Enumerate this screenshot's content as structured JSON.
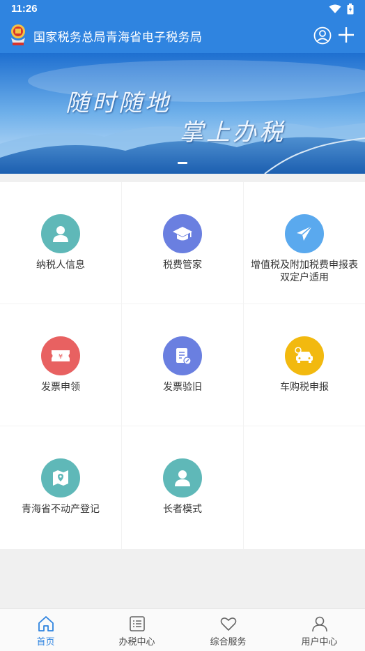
{
  "status": {
    "time": "11:26"
  },
  "header": {
    "title": "国家税务总局青海省电子税务局"
  },
  "banner": {
    "line1": "随时随地",
    "line2": "掌上办税"
  },
  "colors": {
    "primary": "#2f84e0",
    "teal": "#5fb8b8",
    "indigo": "#6a7fe0",
    "sky": "#5aa9ee",
    "red": "#e86161",
    "amber": "#f2b90f"
  },
  "grid": {
    "items": [
      {
        "label": "纳税人信息",
        "icon": "user-icon"
      },
      {
        "label": "税费管家",
        "icon": "graduation-cap-icon"
      },
      {
        "label": "增值税及附加税费申报表双定户适用",
        "icon": "paper-plane-icon"
      },
      {
        "label": "发票申领",
        "icon": "ticket-icon"
      },
      {
        "label": "发票验旧",
        "icon": "document-edit-icon"
      },
      {
        "label": "车购税申报",
        "icon": "car-icon"
      },
      {
        "label": "青海省不动产登记",
        "icon": "map-pin-icon"
      },
      {
        "label": "长者模式",
        "icon": "user-icon"
      }
    ]
  },
  "tabbar": {
    "tabs": [
      {
        "label": "首页",
        "icon": "home-icon",
        "active": true
      },
      {
        "label": "办税中心",
        "icon": "list-icon",
        "active": false
      },
      {
        "label": "综合服务",
        "icon": "heart-icon",
        "active": false
      },
      {
        "label": "用户中心",
        "icon": "person-icon",
        "active": false
      }
    ]
  }
}
